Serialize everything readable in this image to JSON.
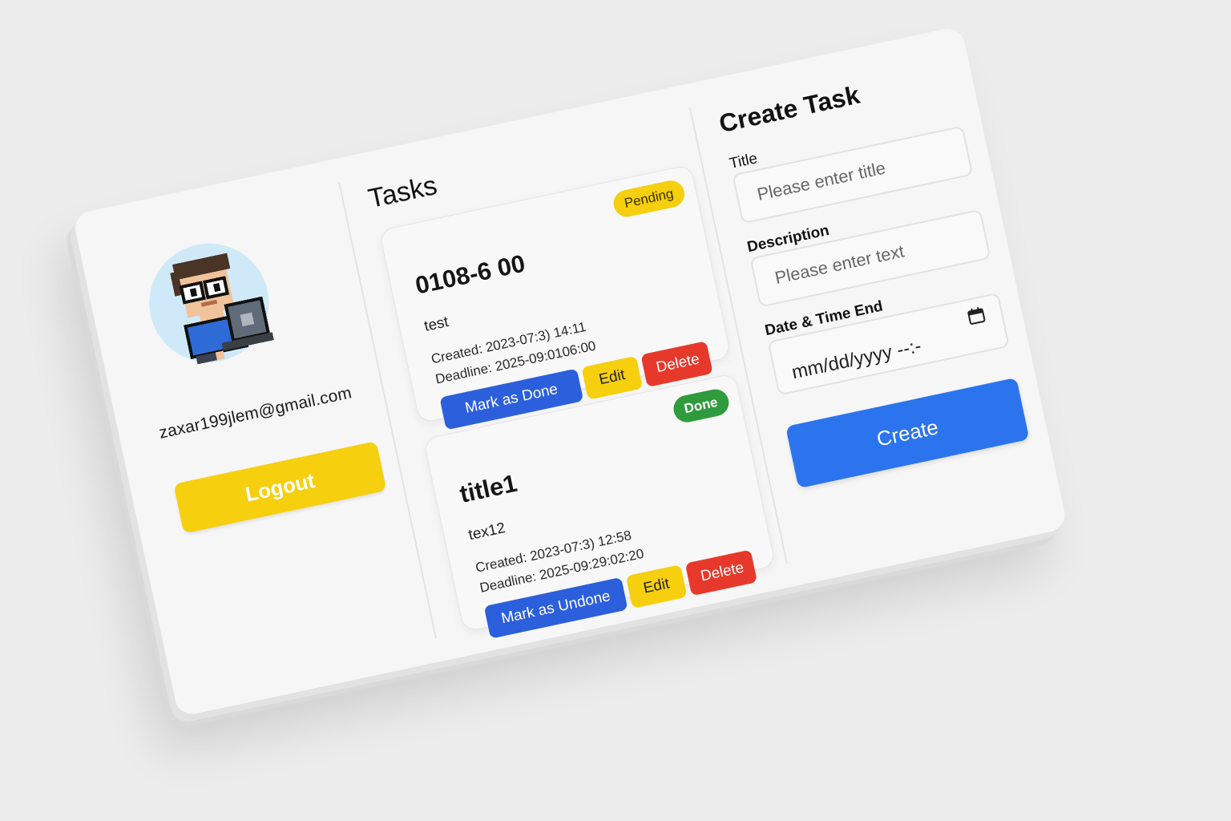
{
  "profile": {
    "email": "zaxar199jlem@gmail.com",
    "logout_label": "Logout"
  },
  "tasks": {
    "heading": "Tasks",
    "items": [
      {
        "status": "Pending",
        "title": "0108-6 00",
        "description": "test",
        "created": "Created: 2023-07:3) 14:11",
        "deadline": "Deadline: 2025-09:0106:00",
        "toggle_label": "Mark as Done",
        "edit_label": "Edit",
        "delete_label": "Delete"
      },
      {
        "status": "Done",
        "title": "title1",
        "description": "tex12",
        "created": "Created: 2023-07:3) 12:58",
        "deadline": "Deadline: 2025-09:29:02:20",
        "toggle_label": "Mark as Undone",
        "edit_label": "Edit",
        "delete_label": "Delete"
      }
    ]
  },
  "create": {
    "heading": "Create Task",
    "title_label": "Title",
    "title_placeholder": "Please enter title",
    "description_label": "Description",
    "description_placeholder": "Please enter text",
    "date_label": "Date & Time End",
    "date_value": "mm/dd/yyyy  --:-",
    "submit_label": "Create"
  },
  "colors": {
    "yellow": "#f6cf0e",
    "blue": "#2c5fdc",
    "red": "#e7392b",
    "green": "#2f9b3c",
    "create_blue": "#2b74ee"
  },
  "icons": {
    "avatar": "pixel-developer-avatar",
    "date": "calendar-icon"
  }
}
